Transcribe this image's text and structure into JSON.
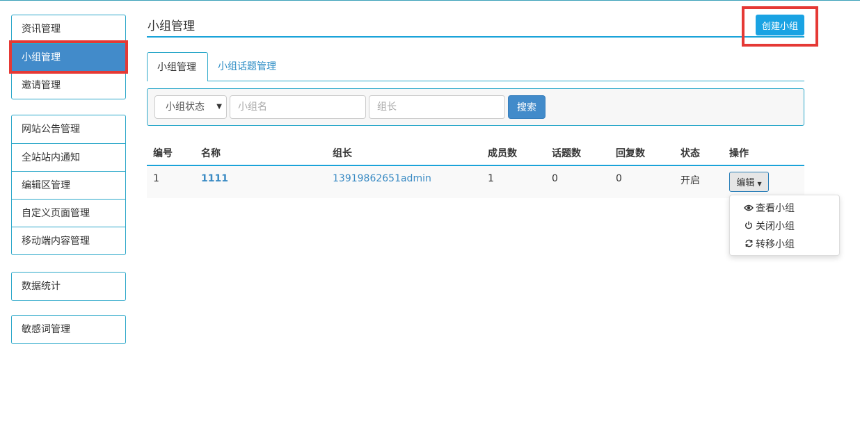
{
  "sidebar": {
    "groups": [
      [
        "资讯管理",
        "小组管理",
        "邀请管理"
      ],
      [
        "网站公告管理",
        "全站站内通知",
        "编辑区管理",
        "自定义页面管理",
        "移动端内容管理"
      ],
      [
        "数据统计"
      ],
      [
        "敏感词管理"
      ]
    ],
    "active_item": "小组管理"
  },
  "header": {
    "title": "小组管理",
    "create_button": "创建小组"
  },
  "tabs": [
    {
      "label": "小组管理",
      "active": true
    },
    {
      "label": "小组话题管理",
      "active": false
    }
  ],
  "filter": {
    "status_select": "小组状态",
    "name_placeholder": "小组名",
    "leader_placeholder": "组长",
    "search_button": "搜索"
  },
  "table": {
    "columns": [
      "编号",
      "名称",
      "组长",
      "成员数",
      "话题数",
      "回复数",
      "状态",
      "操作"
    ],
    "rows": [
      {
        "id": "1",
        "name": "1111",
        "leader": "13919862651admin",
        "members": "1",
        "topics": "0",
        "replies": "0",
        "status": "开启"
      }
    ],
    "edit_button": "编辑"
  },
  "dropdown": [
    {
      "icon": "eye-icon",
      "label": "查看小组"
    },
    {
      "icon": "power-icon",
      "label": "关闭小组"
    },
    {
      "icon": "refresh-icon",
      "label": "转移小组"
    }
  ],
  "colors": {
    "accent": "#1aa3d9",
    "active_bg": "#428bca",
    "highlight": "#e53935"
  }
}
